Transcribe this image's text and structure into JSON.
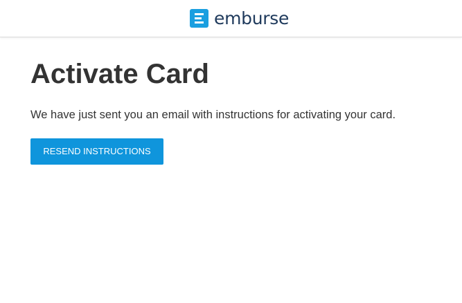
{
  "header": {
    "logo": {
      "icon": "emburse-e-logo-icon",
      "text": "emburse",
      "mark_color": "#1a9fe0",
      "text_color": "#1f3a5c"
    }
  },
  "main": {
    "title": "Activate Card",
    "message": "We have just sent you an email with instructions for activating your card.",
    "resend_button": {
      "label": "RESEND INSTRUCTIONS",
      "color": "#0f95dc"
    }
  }
}
